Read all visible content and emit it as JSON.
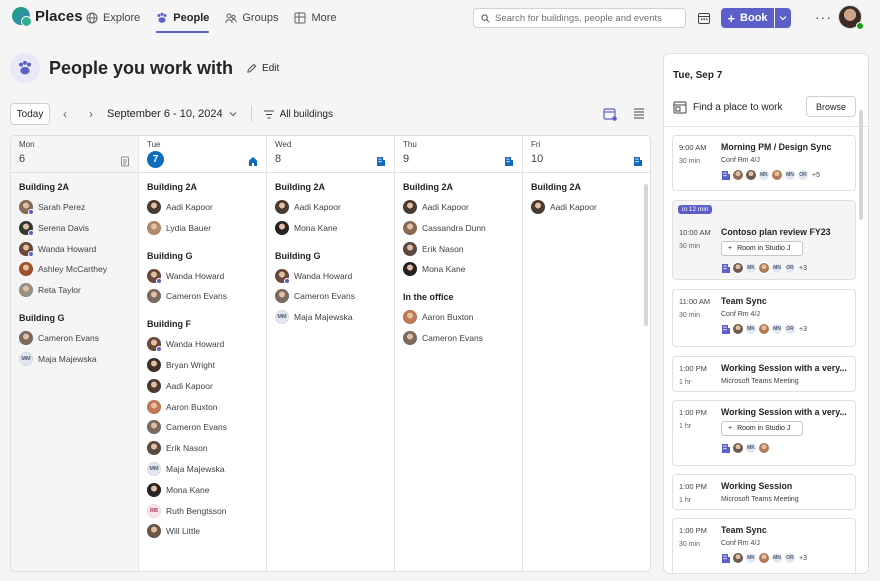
{
  "app": {
    "name": "Places"
  },
  "nav": [
    {
      "label": "Explore",
      "icon": "globe-icon",
      "active": false
    },
    {
      "label": "People",
      "icon": "paw-people-icon",
      "active": true
    },
    {
      "label": "Groups",
      "icon": "groups-icon",
      "active": false
    },
    {
      "label": "More",
      "icon": "grid-icon",
      "active": false
    }
  ],
  "search": {
    "placeholder": "Search for buildings, people and events"
  },
  "book": {
    "label": "Book"
  },
  "page": {
    "title": "People you work with",
    "edit_label": "Edit"
  },
  "toolbar": {
    "today_label": "Today",
    "date_range": "September 6 - 10, 2024",
    "filter_label": "All buildings"
  },
  "days": [
    {
      "dow": "Mon",
      "num": "6",
      "today": false,
      "past": true,
      "groups": [
        {
          "title": "Building 2A",
          "people": [
            {
              "name": "Sarah Perez",
              "color": "#8a6d5a",
              "dot": true
            },
            {
              "name": "Serena Davis",
              "color": "#2e3b2f",
              "dot": true
            },
            {
              "name": "Wanda Howard",
              "color": "#6b4a3a",
              "dot": true
            },
            {
              "name": "Ashley McCarthey",
              "color": "#a0522d",
              "dot": false
            },
            {
              "name": "Reta Taylor",
              "color": "#9a8f85",
              "dot": false
            }
          ]
        },
        {
          "title": "Building G",
          "people": [
            {
              "name": "Cameron Evans",
              "color": "#7b6a60",
              "dot": false
            },
            {
              "name": "Maja Majewska",
              "initials": "MM",
              "dot": false
            }
          ]
        }
      ]
    },
    {
      "dow": "Tue",
      "num": "7",
      "today": true,
      "past": false,
      "groups": [
        {
          "title": "Building 2A",
          "people": [
            {
              "name": "Aadi Kapoor",
              "color": "#4a3b33",
              "dot": false
            },
            {
              "name": "Lydia Bauer",
              "color": "#b08a6a",
              "dot": false
            }
          ]
        },
        {
          "title": "Building G",
          "people": [
            {
              "name": "Wanda Howard",
              "color": "#6b4a3a",
              "dot": true
            },
            {
              "name": "Cameron Evans",
              "color": "#7b6a60",
              "dot": false
            }
          ]
        },
        {
          "title": "Building F",
          "people": [
            {
              "name": "Wanda Howard",
              "color": "#6b4a3a",
              "dot": true
            },
            {
              "name": "Bryan Wright",
              "color": "#3f3029",
              "dot": false
            },
            {
              "name": "Aadi Kapoor",
              "color": "#4a3b33",
              "dot": false
            },
            {
              "name": "Aaron Buxton",
              "color": "#c07a55",
              "dot": false
            },
            {
              "name": "Cameron Evans",
              "color": "#7b6a60",
              "dot": false
            },
            {
              "name": "Erik Nason",
              "color": "#5a4a40",
              "dot": false
            },
            {
              "name": "Maja Majewska",
              "initials": "MM",
              "dot": false
            },
            {
              "name": "Mona Kane",
              "color": "#2a2220",
              "dot": false
            },
            {
              "name": "Ruth Bengtsson",
              "initials": "RB",
              "dot": false,
              "pink": true
            },
            {
              "name": "Will Little",
              "color": "#6a5548",
              "dot": false
            }
          ]
        }
      ]
    },
    {
      "dow": "Wed",
      "num": "8",
      "today": false,
      "past": false,
      "groups": [
        {
          "title": "Building 2A",
          "people": [
            {
              "name": "Aadi Kapoor",
              "color": "#4a3b33",
              "dot": false
            },
            {
              "name": "Mona Kane",
              "color": "#2a2220",
              "dot": false
            }
          ]
        },
        {
          "title": "Building G",
          "people": [
            {
              "name": "Wanda Howard",
              "color": "#6b4a3a",
              "dot": true
            },
            {
              "name": "Cameron Evans",
              "color": "#7b6a60",
              "dot": false
            },
            {
              "name": "Maja Majewska",
              "initials": "MM",
              "dot": false
            }
          ]
        }
      ]
    },
    {
      "dow": "Thu",
      "num": "9",
      "today": false,
      "past": false,
      "groups": [
        {
          "title": "Building 2A",
          "people": [
            {
              "name": "Aadi Kapoor",
              "color": "#4a3b33",
              "dot": false
            },
            {
              "name": "Cassandra Dunn",
              "color": "#8c6a58",
              "dot": false
            },
            {
              "name": "Erik Nason",
              "color": "#5a4a40",
              "dot": false
            },
            {
              "name": "Mona Kane",
              "color": "#2a2220",
              "dot": false
            }
          ]
        },
        {
          "title": "In the office",
          "people": [
            {
              "name": "Aaron Buxton",
              "color": "#c07a55",
              "dot": false
            },
            {
              "name": "Cameron Evans",
              "color": "#7b6a60",
              "dot": false
            }
          ]
        }
      ]
    },
    {
      "dow": "Fri",
      "num": "10",
      "today": false,
      "past": false,
      "groups": [
        {
          "title": "Building 2A",
          "people": [
            {
              "name": "Aadi Kapoor",
              "color": "#4a3b33",
              "dot": false
            }
          ]
        }
      ]
    }
  ],
  "agenda": {
    "date": "Tue, Sep 7",
    "find_label": "Find a place to work",
    "browse_label": "Browse",
    "events": [
      {
        "time": "9:00 AM",
        "dur": "30 min",
        "title": "Morning PM / Design Sync",
        "loc": "Conf Rm 4/J",
        "soon": false,
        "attendees": [
          "p1",
          "p2",
          "MK",
          "p3",
          "MN",
          "OR"
        ],
        "more": "+5"
      },
      {
        "time": "10:00 AM",
        "dur": "30 min",
        "title": "Contoso plan review FY23",
        "loc": "",
        "soon": true,
        "badge": "in 12 min",
        "room": "Room in Studio J",
        "attendees": [
          "p2",
          "MK",
          "p3",
          "MN",
          "OR"
        ],
        "more": "+3"
      },
      {
        "time": "11:00 AM",
        "dur": "30 min",
        "title": "Team Sync",
        "loc": "Conf Rm 4/J",
        "soon": false,
        "attendees": [
          "p2",
          "MK",
          "p3",
          "MN",
          "OR"
        ],
        "more": "+3"
      },
      {
        "time": "1:00 PM",
        "dur": "1 hr",
        "title": "Working Session with a very...",
        "loc": "Microsoft Teams Meeting",
        "soon": false
      },
      {
        "time": "1:00 PM",
        "dur": "1 hr",
        "title": "Working Session with a very...",
        "loc": "",
        "soon": false,
        "room": "Room in Studio J",
        "attendees": [
          "p2",
          "MK",
          "p3"
        ],
        "more": ""
      },
      {
        "time": "1:00 PM",
        "dur": "1 hr",
        "title": "Working Session",
        "loc": "Microsoft Teams Meeting",
        "soon": false
      },
      {
        "time": "1:00 PM",
        "dur": "30 min",
        "title": "Team Sync",
        "loc": "Conf Rm 4/J",
        "soon": false,
        "attendees": [
          "p2",
          "MK",
          "p3",
          "MN",
          "OR"
        ],
        "more": "+3"
      }
    ]
  },
  "colors": {
    "accent": "#5b5fc7",
    "today": "#0f6cbd",
    "building_icon": "#0f6cbd"
  }
}
